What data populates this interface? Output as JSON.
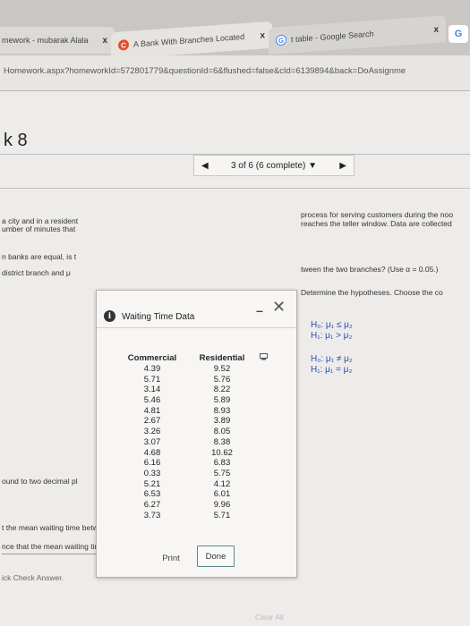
{
  "browser": {
    "tabs": [
      {
        "label": "mework - mubarak Alala",
        "close": "x"
      },
      {
        "favicon": "C",
        "label": "A Bank With Branches Located",
        "close": "x"
      },
      {
        "favicon": "G",
        "label": "t table - Google Search",
        "close": "x"
      }
    ],
    "new_tab_glyph": "G",
    "url": "Homework.aspx?homeworkId=572801779&questionId=6&flushed=false&cId=6139894&back=DoAssignme"
  },
  "page": {
    "title": "k 8",
    "nav": {
      "prev": "◀",
      "position": "3 of 6 (6 complete) ▼",
      "next": "▶"
    },
    "left_lines": [
      "a city and in a resident",
      "umber of minutes that",
      "n banks are equal, is t",
      "district branch and μ",
      "ound to two decimal pl"
    ],
    "right_lines": [
      "process for serving customers during the noo",
      "reaches the teller window. Data are collected",
      "tween the two branches? (Use α = 0.05.)",
      "Determine the hypotheses. Choose the co"
    ],
    "hypotheses": [
      {
        "h0": "H₀: μ₁ ≤ μ₂",
        "h1": "H₁: μ₁ > μ₂"
      },
      {
        "h0": "H₀: μ₁ ≠ μ₂",
        "h1": "H₁: μ₁ = μ₂"
      }
    ],
    "bottom_lines": [
      "t the mean waiting time between the two branches differ.",
      "nce that the mean waiting time between the two branches differ.",
      "ick Check Answer."
    ],
    "clear_all": "Clear All"
  },
  "dialog": {
    "title": "Waiting Time Data",
    "minimize": "–",
    "close": "✕",
    "columns": [
      "Commercial",
      "Residential"
    ],
    "rows": [
      [
        "4.39",
        "9.52"
      ],
      [
        "5.71",
        "5.76"
      ],
      [
        "3.14",
        "8.22"
      ],
      [
        "5.46",
        "5.89"
      ],
      [
        "4.81",
        "8.93"
      ],
      [
        "2.67",
        "3.89"
      ],
      [
        "3.26",
        "8.05"
      ],
      [
        "3.07",
        "8.38"
      ],
      [
        "4.68",
        "10.62"
      ],
      [
        "6.16",
        "6.83"
      ],
      [
        "0.33",
        "5.75"
      ],
      [
        "5.21",
        "4.12"
      ],
      [
        "6.53",
        "6.01"
      ],
      [
        "6.27",
        "9.96"
      ],
      [
        "3.73",
        "5.71"
      ]
    ],
    "print_label": "Print",
    "done_label": "Done"
  }
}
